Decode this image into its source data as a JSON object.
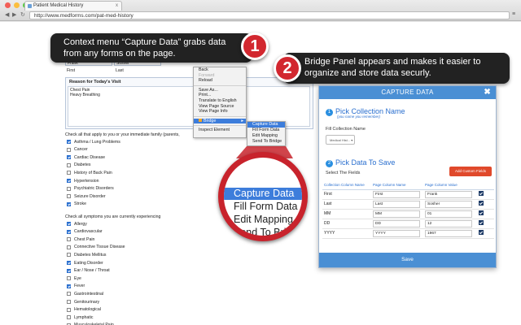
{
  "browser": {
    "tab_title": "Patient Medical History",
    "tab_close": "x",
    "url": "http://www.medforms.com/pat-med-history"
  },
  "form": {
    "first_value": "Frank",
    "last_value": "Sosher",
    "first_label": "First",
    "last_label": "Last",
    "reason_header": "Reason for Today's Visit",
    "reason_text": [
      "Chest Pain",
      "Heavy Breathing"
    ],
    "check_header_1": "Check all that apply to you or your immediate family (parents,",
    "conditions_1": [
      {
        "label": "Asthma / Lung Problems",
        "checked": true
      },
      {
        "label": "Cancer",
        "checked": false
      },
      {
        "label": "Cardiac Disease",
        "checked": true
      },
      {
        "label": "Diabetes",
        "checked": false
      },
      {
        "label": "History of Back Pain",
        "checked": false
      },
      {
        "label": "Hypertension",
        "checked": true
      },
      {
        "label": "Psychiatric Disorders",
        "checked": false
      },
      {
        "label": "Seizure Disorder",
        "checked": false
      },
      {
        "label": "Stroke",
        "checked": true
      }
    ],
    "check_header_2": "Check all symptoms you are currently experiencing",
    "conditions_2": [
      {
        "label": "Allergy",
        "checked": true
      },
      {
        "label": "Cardiovascular",
        "checked": true
      },
      {
        "label": "Chest Pain",
        "checked": false
      },
      {
        "label": "Connective Tissue Disease",
        "checked": false
      },
      {
        "label": "Diabetes Mellitus",
        "checked": false
      },
      {
        "label": "Eating Disorder",
        "checked": true
      },
      {
        "label": "Ear / Nose / Throat",
        "checked": true
      },
      {
        "label": "Eye",
        "checked": false
      },
      {
        "label": "Fever",
        "checked": true
      },
      {
        "label": "Gastrointestinal",
        "checked": false
      },
      {
        "label": "Genitourinary",
        "checked": false
      },
      {
        "label": "Hematological",
        "checked": false
      },
      {
        "label": "Lymphatic",
        "checked": false
      },
      {
        "label": "Musculoskeletal Pain",
        "checked": false
      }
    ]
  },
  "context_menu": {
    "items": [
      "Back",
      "Forward",
      "Reload"
    ],
    "items2": [
      "Save As...",
      "Print...",
      "Translate to English",
      "View Page Source",
      "View Page Info"
    ],
    "bridge": "Bridge",
    "bridge_arrow": "▸",
    "inspect": "Inspect Element",
    "submenu": [
      "Capture Data",
      "Fill Form Data",
      "Edit Mapping",
      "Send To Bridge"
    ]
  },
  "callouts": {
    "one_text": "Context menu “Capture Data” grabs data from any forms on the page.",
    "one_num": "1",
    "two_text": "Bridge Panel appears and makes it easier to organize and store data securly.",
    "two_num": "2"
  },
  "magnifier": [
    "Capture Data",
    "Fill Form Data",
    "Edit Mapping",
    "Send To Bridge"
  ],
  "panel": {
    "title": "CAPTURE DATA",
    "close": "✖",
    "sec1_num": "1",
    "sec1_title": "Pick Collection Name",
    "sec1_note": "(you name you remember)",
    "fill_label": "Fill Collection Name",
    "select_value": "Medical Hist... ▾",
    "sec2_num": "2",
    "sec2_title": "Pick Data To Save",
    "select_fields": "Select The Fields",
    "add_button": "Add Custom Fields",
    "columns": [
      "Collection Column Name",
      "Page Column Name",
      "Page Column Value"
    ],
    "rows": [
      [
        "First",
        "First",
        "Frank"
      ],
      [
        "Last",
        "Last",
        "Sosher"
      ],
      [
        "MM",
        "MM",
        "01"
      ],
      [
        "DD",
        "DD",
        "12"
      ],
      [
        "YYYY",
        "YYYY",
        "1967"
      ]
    ],
    "save": "Save"
  },
  "colors": {
    "accent": "#4a8fd4",
    "callout_bg": "#222222",
    "badge_red": "#d2272f",
    "add_button": "#e0492b"
  }
}
